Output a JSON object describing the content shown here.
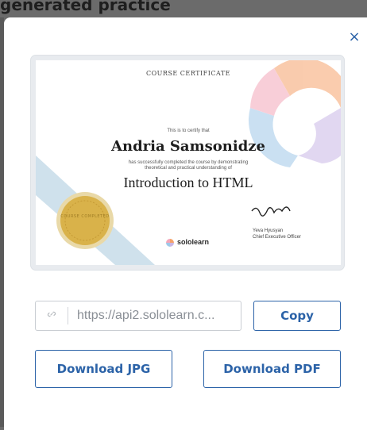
{
  "background": {
    "page_title": "generated practice"
  },
  "modal": {
    "close_symbol": "×"
  },
  "certificate": {
    "kicker": "COURSE CERTIFICATE",
    "intro": "This is to certify that",
    "recipient": "Andria Samsonidze",
    "statement_line1": "has successfully completed the course by demonstrating",
    "statement_line2": "theoretical and practical understanding of",
    "course": "Introduction to HTML",
    "signer_name": "Yeva Hyusyan",
    "signer_title": "Chief Executive Officer",
    "brand": "sololearn",
    "seal_text": "COURSE COMPLETED",
    "colors": {
      "seal_gold": "#d9b24a",
      "ribbon_blue": "#cfe1ec",
      "logo_orange": "#f5a26b",
      "logo_blue": "#9fc8e8",
      "logo_purple": "#c9b7e6",
      "logo_pink": "#f4a7b9"
    }
  },
  "share": {
    "link_value": "https://api2.sololearn.c...",
    "copy_label": "Copy",
    "download_jpg_label": "Download JPG",
    "download_pdf_label": "Download PDF"
  },
  "colors": {
    "accent": "#2c63a8",
    "overlay": "#6b6b6b"
  }
}
